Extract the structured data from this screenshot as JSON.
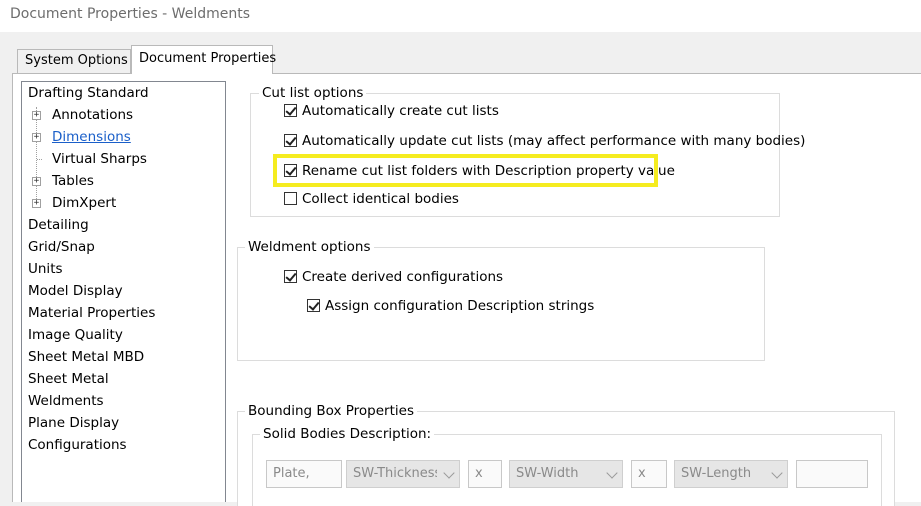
{
  "window": {
    "title": "Document Properties - Weldments"
  },
  "tabs": [
    {
      "label": "System Options",
      "active": false
    },
    {
      "label": "Document Properties",
      "active": true
    }
  ],
  "tree": {
    "items": [
      {
        "label": "Drafting Standard",
        "level": 0,
        "expandable": false
      },
      {
        "label": "Annotations",
        "level": 1,
        "expandable": true
      },
      {
        "label": "Dimensions",
        "level": 1,
        "expandable": true,
        "selected_link": true
      },
      {
        "label": "Virtual Sharps",
        "level": 1,
        "expandable": false
      },
      {
        "label": "Tables",
        "level": 1,
        "expandable": true
      },
      {
        "label": "DimXpert",
        "level": 1,
        "expandable": true
      },
      {
        "label": "Detailing",
        "level": 0
      },
      {
        "label": "Grid/Snap",
        "level": 0
      },
      {
        "label": "Units",
        "level": 0
      },
      {
        "label": "Model Display",
        "level": 0
      },
      {
        "label": "Material Properties",
        "level": 0
      },
      {
        "label": "Image Quality",
        "level": 0
      },
      {
        "label": "Sheet Metal MBD",
        "level": 0
      },
      {
        "label": "Sheet Metal",
        "level": 0
      },
      {
        "label": "Weldments",
        "level": 0
      },
      {
        "label": "Plane Display",
        "level": 0
      },
      {
        "label": "Configurations",
        "level": 0
      }
    ]
  },
  "cut_list": {
    "legend": "Cut list options",
    "options": [
      {
        "label": "Automatically create cut lists",
        "checked": true
      },
      {
        "label": "Automatically update cut lists (may affect performance with many bodies)",
        "checked": true
      },
      {
        "label": "Rename cut list folders with Description property value",
        "checked": true
      },
      {
        "label": "Collect identical bodies",
        "checked": false
      }
    ]
  },
  "weldment": {
    "legend": "Weldment options",
    "options": [
      {
        "label": "Create derived configurations",
        "checked": true
      },
      {
        "label": "Assign configuration Description strings",
        "checked": true
      }
    ]
  },
  "bounding_box": {
    "legend": "Bounding Box Properties",
    "sub_legend": "Solid Bodies Description:",
    "prefix": "Plate,",
    "thickness": "SW-Thickness",
    "sep1": "x",
    "width": "SW-Width",
    "sep2": "x",
    "length": "SW-Length",
    "suffix": ""
  },
  "colors": {
    "highlight": "#f5ec1f",
    "link": "#1a5fc9"
  }
}
